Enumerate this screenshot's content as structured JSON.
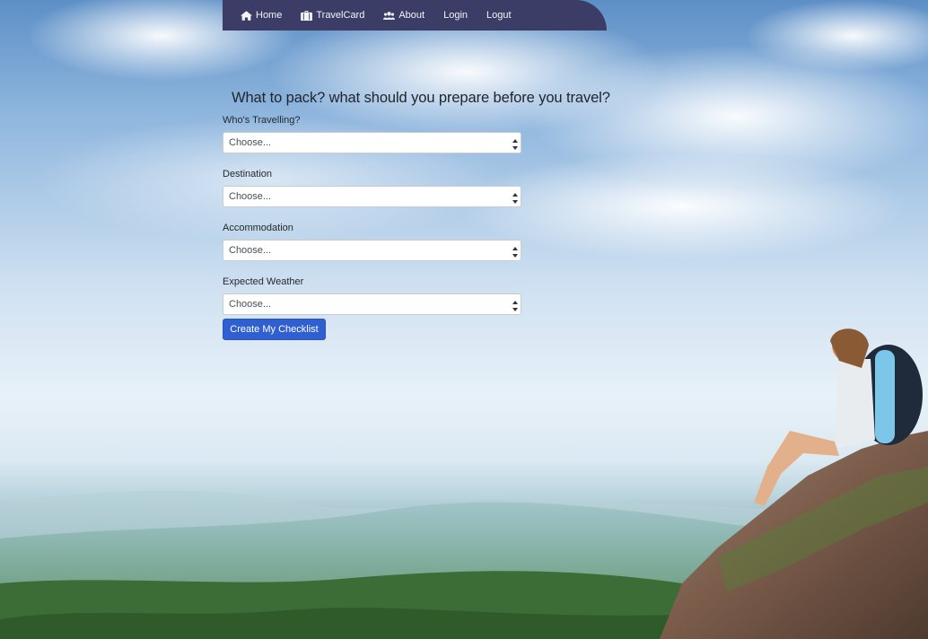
{
  "nav": {
    "items": [
      {
        "label": "Home",
        "icon": "home-icon"
      },
      {
        "label": "TravelCard",
        "icon": "suitcase-icon"
      },
      {
        "label": "About",
        "icon": "users-icon"
      },
      {
        "label": "Login",
        "icon": ""
      },
      {
        "label": "Logut",
        "icon": ""
      }
    ],
    "background": "#3b3d66"
  },
  "heading": "What to pack? what should you prepare before you travel?",
  "form": {
    "fields": [
      {
        "label": "Who's Travelling?",
        "selected": "Choose..."
      },
      {
        "label": "Destination",
        "selected": "Choose..."
      },
      {
        "label": "Accommodation",
        "selected": "Choose..."
      },
      {
        "label": "Expected Weather",
        "selected": "Choose..."
      }
    ],
    "submit_label": "Create My Checklist",
    "submit_color": "#2f5fd0"
  }
}
